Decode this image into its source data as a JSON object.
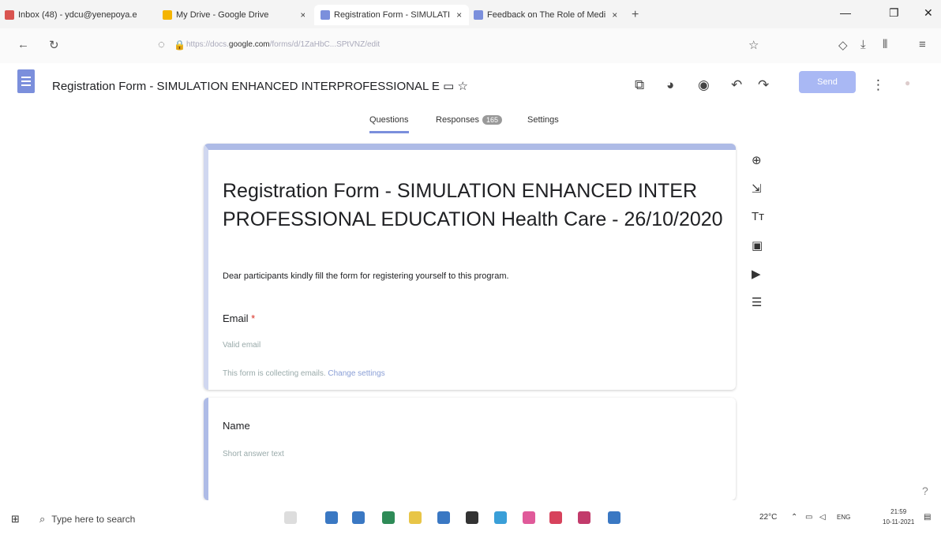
{
  "browser": {
    "tabs": [
      {
        "title": "Inbox (48) - ydcu@yenepoya.e",
        "color": "#d9534f"
      },
      {
        "title": "My Drive - Google Drive",
        "color": "#f4b400"
      },
      {
        "title": "Registration Form - SIMULATI",
        "color": "#7b8fdc"
      },
      {
        "title": "Feedback on The Role of Medi",
        "color": "#7b8fdc"
      }
    ],
    "new_tab_icon": "+",
    "url_domain": "google.com",
    "url_prefix": "https://docs.",
    "url_suffix": "/forms/d/1ZaHbC...SPtVNZ/edit",
    "close_glyph": "×"
  },
  "header": {
    "title": "Registration Form - SIMULATION ENHANCED INTERPROFESSIONAL E",
    "send_label": "Send"
  },
  "tabs": {
    "questions": "Questions",
    "responses": "Responses",
    "responses_count": "165",
    "settings": "Settings"
  },
  "form": {
    "title": "Registration Form - SIMULATION ENHANCED INTER PROFESSIONAL EDUCATION Health Care - 26/10/2020",
    "description": "Dear participants kindly fill the form for registering yourself to this program.",
    "email_label": "Email",
    "required_mark": "*",
    "email_placeholder": "Valid email",
    "collecting_note": "This form is collecting emails.",
    "change_settings": "Change settings",
    "name_label": "Name",
    "name_placeholder": "Short answer text"
  },
  "taskbar": {
    "search_placeholder": "Type here to search",
    "temperature": "22°C",
    "language": "ENG",
    "time": "21:59",
    "date": "10-11-2021"
  },
  "colors": {
    "accent": "#7b8fdc",
    "send": "#a9b8f4"
  }
}
